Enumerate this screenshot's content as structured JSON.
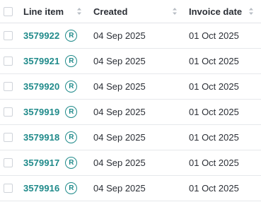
{
  "table": {
    "columns": {
      "line_item": "Line item",
      "created": "Created",
      "invoice_date": "Invoice date"
    },
    "icons": {
      "sort": "sort-icon",
      "badge": "r-badge-icon"
    },
    "colors": {
      "link": "#1f8a8a",
      "border": "#e6e8eb",
      "checkbox_border": "#cfd3d9",
      "sort_arrow": "#b8bdc4"
    },
    "rows": [
      {
        "line_item": "3579922",
        "badge": "R",
        "created": "04 Sep 2025",
        "invoice_date": "01 Oct 2025"
      },
      {
        "line_item": "3579921",
        "badge": "R",
        "created": "04 Sep 2025",
        "invoice_date": "01 Oct 2025"
      },
      {
        "line_item": "3579920",
        "badge": "R",
        "created": "04 Sep 2025",
        "invoice_date": "01 Oct 2025"
      },
      {
        "line_item": "3579919",
        "badge": "R",
        "created": "04 Sep 2025",
        "invoice_date": "01 Oct 2025"
      },
      {
        "line_item": "3579918",
        "badge": "R",
        "created": "04 Sep 2025",
        "invoice_date": "01 Oct 2025"
      },
      {
        "line_item": "3579917",
        "badge": "R",
        "created": "04 Sep 2025",
        "invoice_date": "01 Oct 2025"
      },
      {
        "line_item": "3579916",
        "badge": "R",
        "created": "04 Sep 2025",
        "invoice_date": "01 Oct 2025"
      }
    ]
  }
}
